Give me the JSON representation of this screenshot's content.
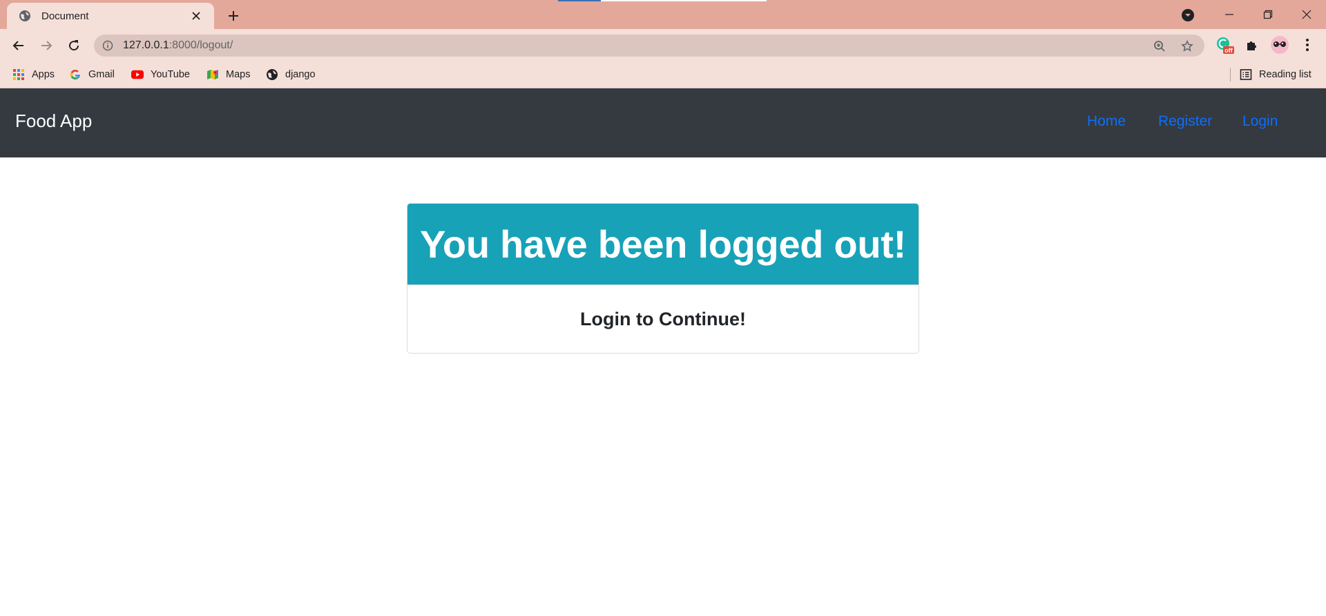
{
  "browser": {
    "tab": {
      "title": "Document",
      "favicon": "globe-icon"
    },
    "address": {
      "host": "127.0.0.1",
      "path": ":8000/logout/"
    },
    "bookmarks": [
      {
        "label": "Apps",
        "icon": "apps-grid-icon"
      },
      {
        "label": "Gmail",
        "icon": "google-icon"
      },
      {
        "label": "YouTube",
        "icon": "youtube-icon"
      },
      {
        "label": "Maps",
        "icon": "maps-icon"
      },
      {
        "label": "django",
        "icon": "globe-icon"
      }
    ],
    "reading_list_label": "Reading list",
    "extension_badge": "off",
    "colors": {
      "tabstrip": "#e3a899",
      "toolbar": "#f5e0d9",
      "omnibox": "#dcc5be"
    }
  },
  "navbar": {
    "brand": "Food App",
    "links": [
      "Home",
      "Register",
      "Login"
    ],
    "colors": {
      "background": "#343a40",
      "link": "#0d6efd"
    }
  },
  "card": {
    "header": "You have been logged out!",
    "body": "Login to Continue!",
    "colors": {
      "header_bg": "#17a2b8"
    }
  }
}
